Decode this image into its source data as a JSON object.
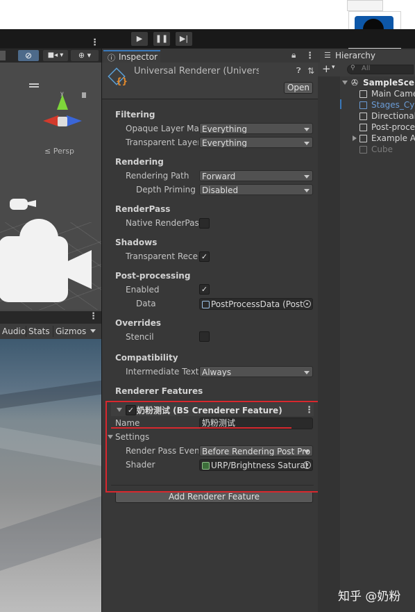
{
  "colors": {
    "accent_blue": "#3a79bb",
    "annotation_red": "#d8282e",
    "inspector_bg": "#383838",
    "field_bg": "#515151"
  },
  "toolbar": {
    "play_icon": "play-icon",
    "pause_icon": "pause-icon",
    "step_icon": "step-icon"
  },
  "scene": {
    "persp_label": "≤ Persp"
  },
  "game": {
    "tabs": [
      "Audio",
      "Stats",
      "Gizmos"
    ]
  },
  "inspector": {
    "tab_label": "Inspector",
    "object_title": "Universal Renderer (Universal Rende",
    "open_button": "Open",
    "sections": {
      "filtering": "Filtering",
      "rendering": "Rendering",
      "renderpass": "RenderPass",
      "shadows": "Shadows",
      "postprocessing": "Post-processing",
      "overrides": "Overrides",
      "compatibility": "Compatibility",
      "renderer_features": "Renderer Features"
    },
    "fields": {
      "opaque_label": "Opaque Layer Mas",
      "opaque_value": "Everything",
      "transparent_label": "Transparent Layer",
      "transparent_value": "Everything",
      "rendering_path_label": "Rendering Path",
      "rendering_path_value": "Forward",
      "depth_priming_label": "Depth Priming M",
      "depth_priming_value": "Disabled",
      "native_renderpass_label": "Native RenderPass",
      "transparent_receive_label": "Transparent Recei",
      "enabled_label": "Enabled",
      "data_label": "Data",
      "data_value": "PostProcessData (Post",
      "stencil_label": "Stencil",
      "intermediate_label": "Intermediate Textu",
      "intermediate_value": "Always"
    },
    "feature": {
      "title": "奶粉测试 (BS Crenderer Feature)",
      "name_label": "Name",
      "name_value": "奶粉测试",
      "settings_label": "Settings",
      "render_pass_event_label": "Render Pass Event",
      "render_pass_event_value": "Before Rendering Post Pro",
      "shader_label": "Shader",
      "shader_value": "URP/Brightness Saturat"
    },
    "add_feature_button": "Add Renderer Feature"
  },
  "hierarchy": {
    "tab_label": "Hierarchy",
    "search_placeholder": "All",
    "scene_name": "SampleScen",
    "items": [
      {
        "label": "Main Came",
        "style": "normal"
      },
      {
        "label": "Stages_Cy",
        "style": "blue"
      },
      {
        "label": "Directional",
        "style": "normal"
      },
      {
        "label": "Post-proce",
        "style": "normal"
      },
      {
        "label": "Example As",
        "style": "normal"
      },
      {
        "label": "Cube",
        "style": "dim"
      }
    ]
  },
  "watermark": "知乎 @奶粉"
}
